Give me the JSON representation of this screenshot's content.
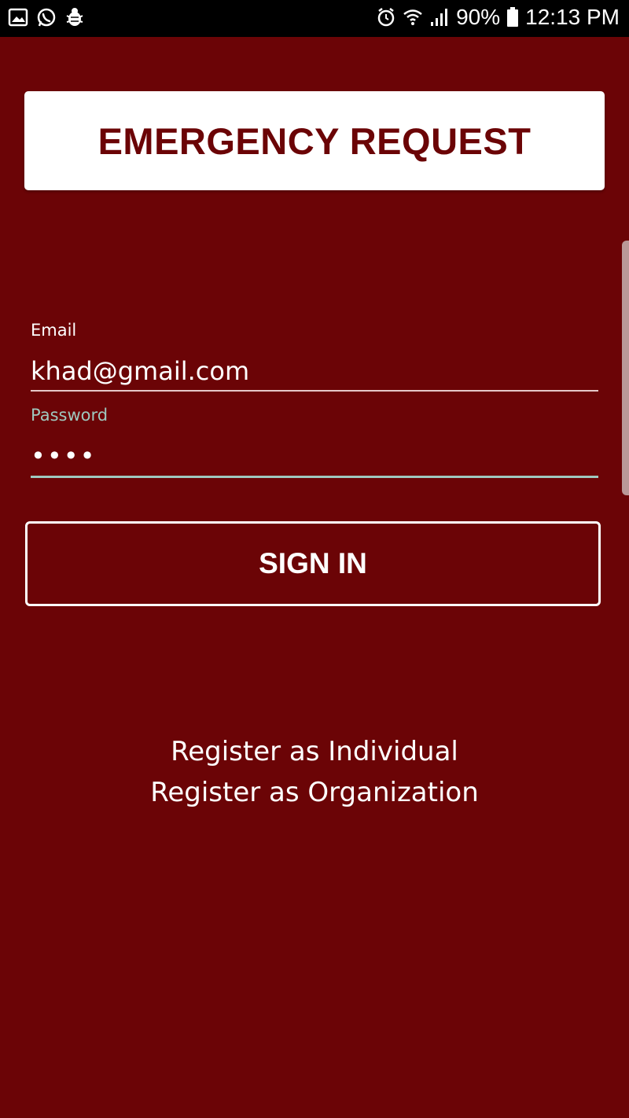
{
  "status_bar": {
    "battery": "90%",
    "time": "12:13 PM",
    "icons": [
      "gallery-icon",
      "whatsapp-icon",
      "bug-icon",
      "alarm-icon",
      "wifi-icon",
      "signal-icon",
      "battery-icon"
    ]
  },
  "header": {
    "title": "EMERGENCY REQUEST"
  },
  "form": {
    "email_label": "Email",
    "email_value": "khad@gmail.com",
    "password_label": "Password",
    "password_value": "••••"
  },
  "actions": {
    "signin_label": "SIGN IN",
    "register_individual": "Register as Individual",
    "register_organization": "Register as Organization"
  },
  "colors": {
    "background": "#6b0406",
    "accent": "#9fc9bf",
    "card": "#ffffff"
  }
}
